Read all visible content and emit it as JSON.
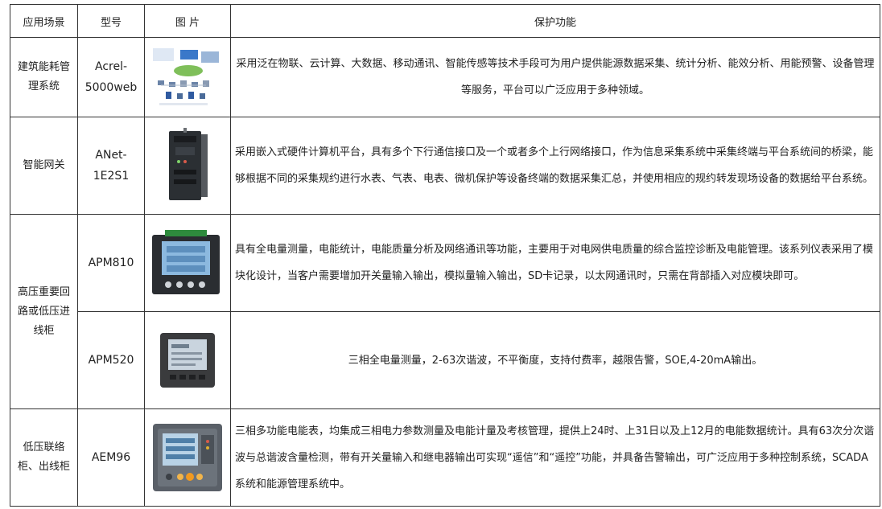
{
  "header": {
    "col_scene": "应用场景",
    "col_model": "型号",
    "col_picture": "图 片",
    "col_function": "保护功能"
  },
  "rows": [
    {
      "scene": "建筑能耗管理系统",
      "model": "Acrel-5000web",
      "function": "采用泛在物联、云计算、大数据、移动通讯、智能传感等技术手段可为用户提供能源数据采集、统计分析、能效分析、用能预警、设备管理等服务，平台可以广泛应用于多种领域。"
    },
    {
      "scene": "智能网关",
      "model": "ANet-1E2S1",
      "function": "采用嵌入式硬件计算机平台，具有多个下行通信接口及一个或者多个上行网络接口，作为信息采集系统中采集终端与平台系统间的桥梁，能够根据不同的采集规约进行水表、气表、电表、微机保护等设备终端的数据采集汇总，并使用相应的规约转发现场设备的数据给平台系统。"
    },
    {
      "scene": "高压重要回路或低压进线柜",
      "model": "APM810",
      "function": "具有全电量测量，电能统计，电能质量分析及网络通讯等功能，主要用于对电网供电质量的综合监控诊断及电能管理。该系列仪表采用了模块化设计，当客户需要增加开关量输入输出，模拟量输入输出，SD卡记录，以太网通讯时，只需在背部插入对应模块即可。"
    },
    {
      "model": "APM520",
      "function": "三相全电量测量，2-63次谐波，不平衡度，支持付费率，越限告警，SOE,4-20mA输出。"
    },
    {
      "scene": "低压联络柜、出线柜",
      "model": "AEM96",
      "function": "三相多功能电能表，均集成三相电力参数测量及电能计量及考核管理，提供上24时、上31日以及上12月的电能数据统计。具有63次分次谐波与总谐波含量检测，带有开关量输入和继电器输出可实现“遥信”和“遥控”功能，并具备告警输出，可广泛应用于多种控制系统，SCADA系统和能源管理系统中。"
    }
  ]
}
